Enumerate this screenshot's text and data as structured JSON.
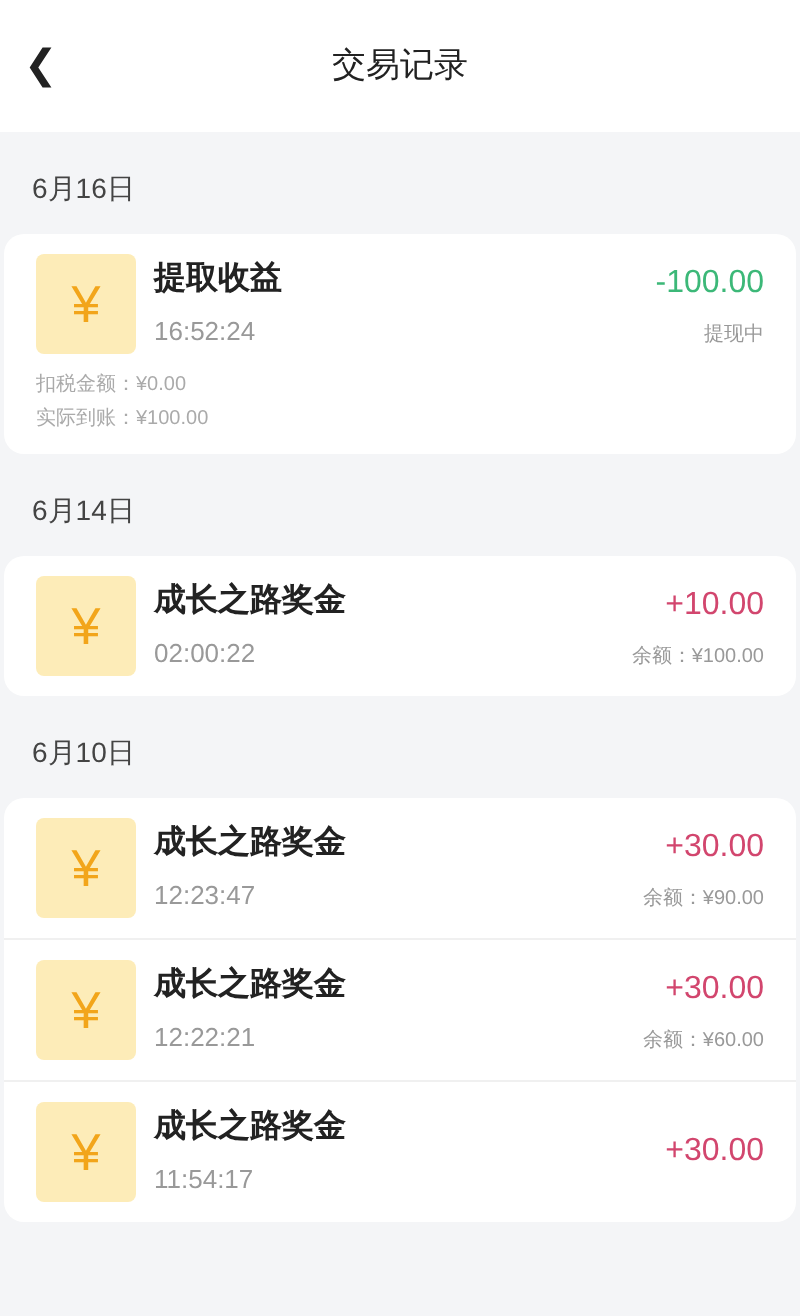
{
  "header": {
    "back": "❮",
    "title": "交易记录"
  },
  "groups": [
    {
      "date": "6月16日",
      "items": [
        {
          "kind": "debit",
          "symbol": "¥",
          "title": "提取收益",
          "time": "16:52:24",
          "amount": "-100.00",
          "note": "提现中",
          "details": [
            "扣税金额：¥0.00",
            "实际到账：¥100.00"
          ]
        }
      ]
    },
    {
      "date": "6月14日",
      "items": [
        {
          "kind": "credit",
          "symbol": "¥",
          "title": "成长之路奖金",
          "time": "02:00:22",
          "amount": "+10.00",
          "note": "余额：¥100.00"
        }
      ]
    },
    {
      "date": "6月10日",
      "items": [
        {
          "kind": "credit",
          "symbol": "¥",
          "title": "成长之路奖金",
          "time": "12:23:47",
          "amount": "+30.00",
          "note": "余额：¥90.00"
        },
        {
          "kind": "credit",
          "symbol": "¥",
          "title": "成长之路奖金",
          "time": "12:22:21",
          "amount": "+30.00",
          "note": "余额：¥60.00"
        },
        {
          "kind": "credit",
          "symbol": "¥",
          "title": "成长之路奖金",
          "time": "11:54:17",
          "amount": "+30.00"
        }
      ]
    }
  ]
}
